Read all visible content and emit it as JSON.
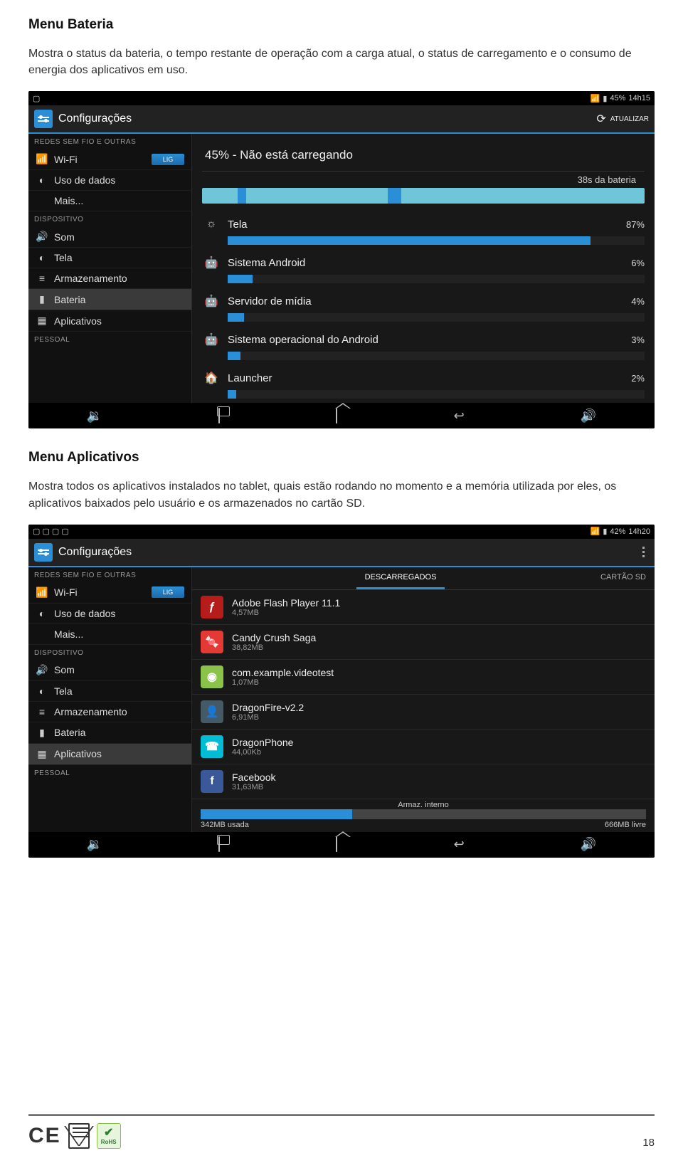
{
  "doc": {
    "section1_title": "Menu Bateria",
    "section1_text": "Mostra o status da bateria, o tempo restante de operação com a carga atual, o status de carregamento e o consumo de energia dos aplicativos em uso.",
    "section2_title": "Menu Aplicativos",
    "section2_text": "Mostra todos os aplicativos instalados no tablet, quais estão rodando no momento e a memória utilizada por eles, os aplicativos baixados pelo usuário e os armazenados no cartão SD.",
    "page_number": "18",
    "badges": {
      "ce": "CE",
      "rohs_label": "RoHS"
    }
  },
  "shot1": {
    "status_left_icons": "▢",
    "status_right": {
      "batt": "45%",
      "time": "14h15"
    },
    "title": "Configurações",
    "refresh_label": "ATUALIZAR",
    "sidebar": {
      "group1": "REDES SEM FIO E OUTRAS",
      "items1": [
        {
          "icon": "wifi",
          "label": "Wi-Fi",
          "toggle": "LIG"
        },
        {
          "icon": "data",
          "label": "Uso de dados"
        },
        {
          "icon": "",
          "label": "Mais..."
        }
      ],
      "group2": "DISPOSITIVO",
      "items2": [
        {
          "icon": "sound",
          "label": "Som"
        },
        {
          "icon": "display",
          "label": "Tela"
        },
        {
          "icon": "storage",
          "label": "Armazenamento"
        },
        {
          "icon": "battery",
          "label": "Bateria",
          "selected": true
        },
        {
          "icon": "apps",
          "label": "Aplicativos"
        }
      ],
      "group3": "PESSOAL"
    },
    "main": {
      "charge_status": "45% - Não está carregando",
      "time_on_battery": "38s da bateria",
      "usage": [
        {
          "name": "Tela",
          "pct": "87%",
          "bar": 87,
          "icon": "brightness",
          "color": "#ccc"
        },
        {
          "name": "Sistema Android",
          "pct": "6%",
          "bar": 6,
          "icon": "android",
          "color": "#4caf50"
        },
        {
          "name": "Servidor de mídia",
          "pct": "4%",
          "bar": 4,
          "icon": "android",
          "color": "#4caf50"
        },
        {
          "name": "Sistema operacional do Android",
          "pct": "3%",
          "bar": 3,
          "icon": "android",
          "color": "#4caf50"
        },
        {
          "name": "Launcher",
          "pct": "2%",
          "bar": 2,
          "icon": "home",
          "color": "#8bc34a"
        }
      ]
    }
  },
  "shot2": {
    "status_left_icons": "▢ ▢ ▢ ▢",
    "status_right": {
      "batt": "42%",
      "time": "14h20"
    },
    "title": "Configurações",
    "sidebar": {
      "group1": "REDES SEM FIO E OUTRAS",
      "items1": [
        {
          "icon": "wifi",
          "label": "Wi-Fi",
          "toggle": "LIG"
        },
        {
          "icon": "data",
          "label": "Uso de dados"
        },
        {
          "icon": "",
          "label": "Mais..."
        }
      ],
      "group2": "DISPOSITIVO",
      "items2": [
        {
          "icon": "sound",
          "label": "Som"
        },
        {
          "icon": "display",
          "label": "Tela"
        },
        {
          "icon": "storage",
          "label": "Armazenamento"
        },
        {
          "icon": "battery",
          "label": "Bateria"
        },
        {
          "icon": "apps",
          "label": "Aplicativos",
          "selected": true
        }
      ],
      "group3": "PESSOAL"
    },
    "tabs": {
      "left_hidden": "",
      "active": "DESCARREGADOS",
      "right": "CARTÃO SD"
    },
    "apps": [
      {
        "name": "Adobe Flash Player 11.1",
        "size": "4,57MB",
        "bg": "#b71c1c",
        "glyph": "ƒ"
      },
      {
        "name": "Candy Crush Saga",
        "size": "38,82MB",
        "bg": "#e53935",
        "glyph": "🍬"
      },
      {
        "name": "com.example.videotest",
        "size": "1,07MB",
        "bg": "#8bc34a",
        "glyph": "◉"
      },
      {
        "name": "DragonFire-v2.2",
        "size": "6,91MB",
        "bg": "#455a64",
        "glyph": "👤"
      },
      {
        "name": "DragonPhone",
        "size": "44,00Kb",
        "bg": "#00bcd4",
        "glyph": "☎"
      },
      {
        "name": "Facebook",
        "size": "31,63MB",
        "bg": "#3b5998",
        "glyph": "f"
      }
    ],
    "storage": {
      "title": "Armaz. interno",
      "used": "342MB usada",
      "free": "666MB livre",
      "used_pct": 34
    }
  }
}
